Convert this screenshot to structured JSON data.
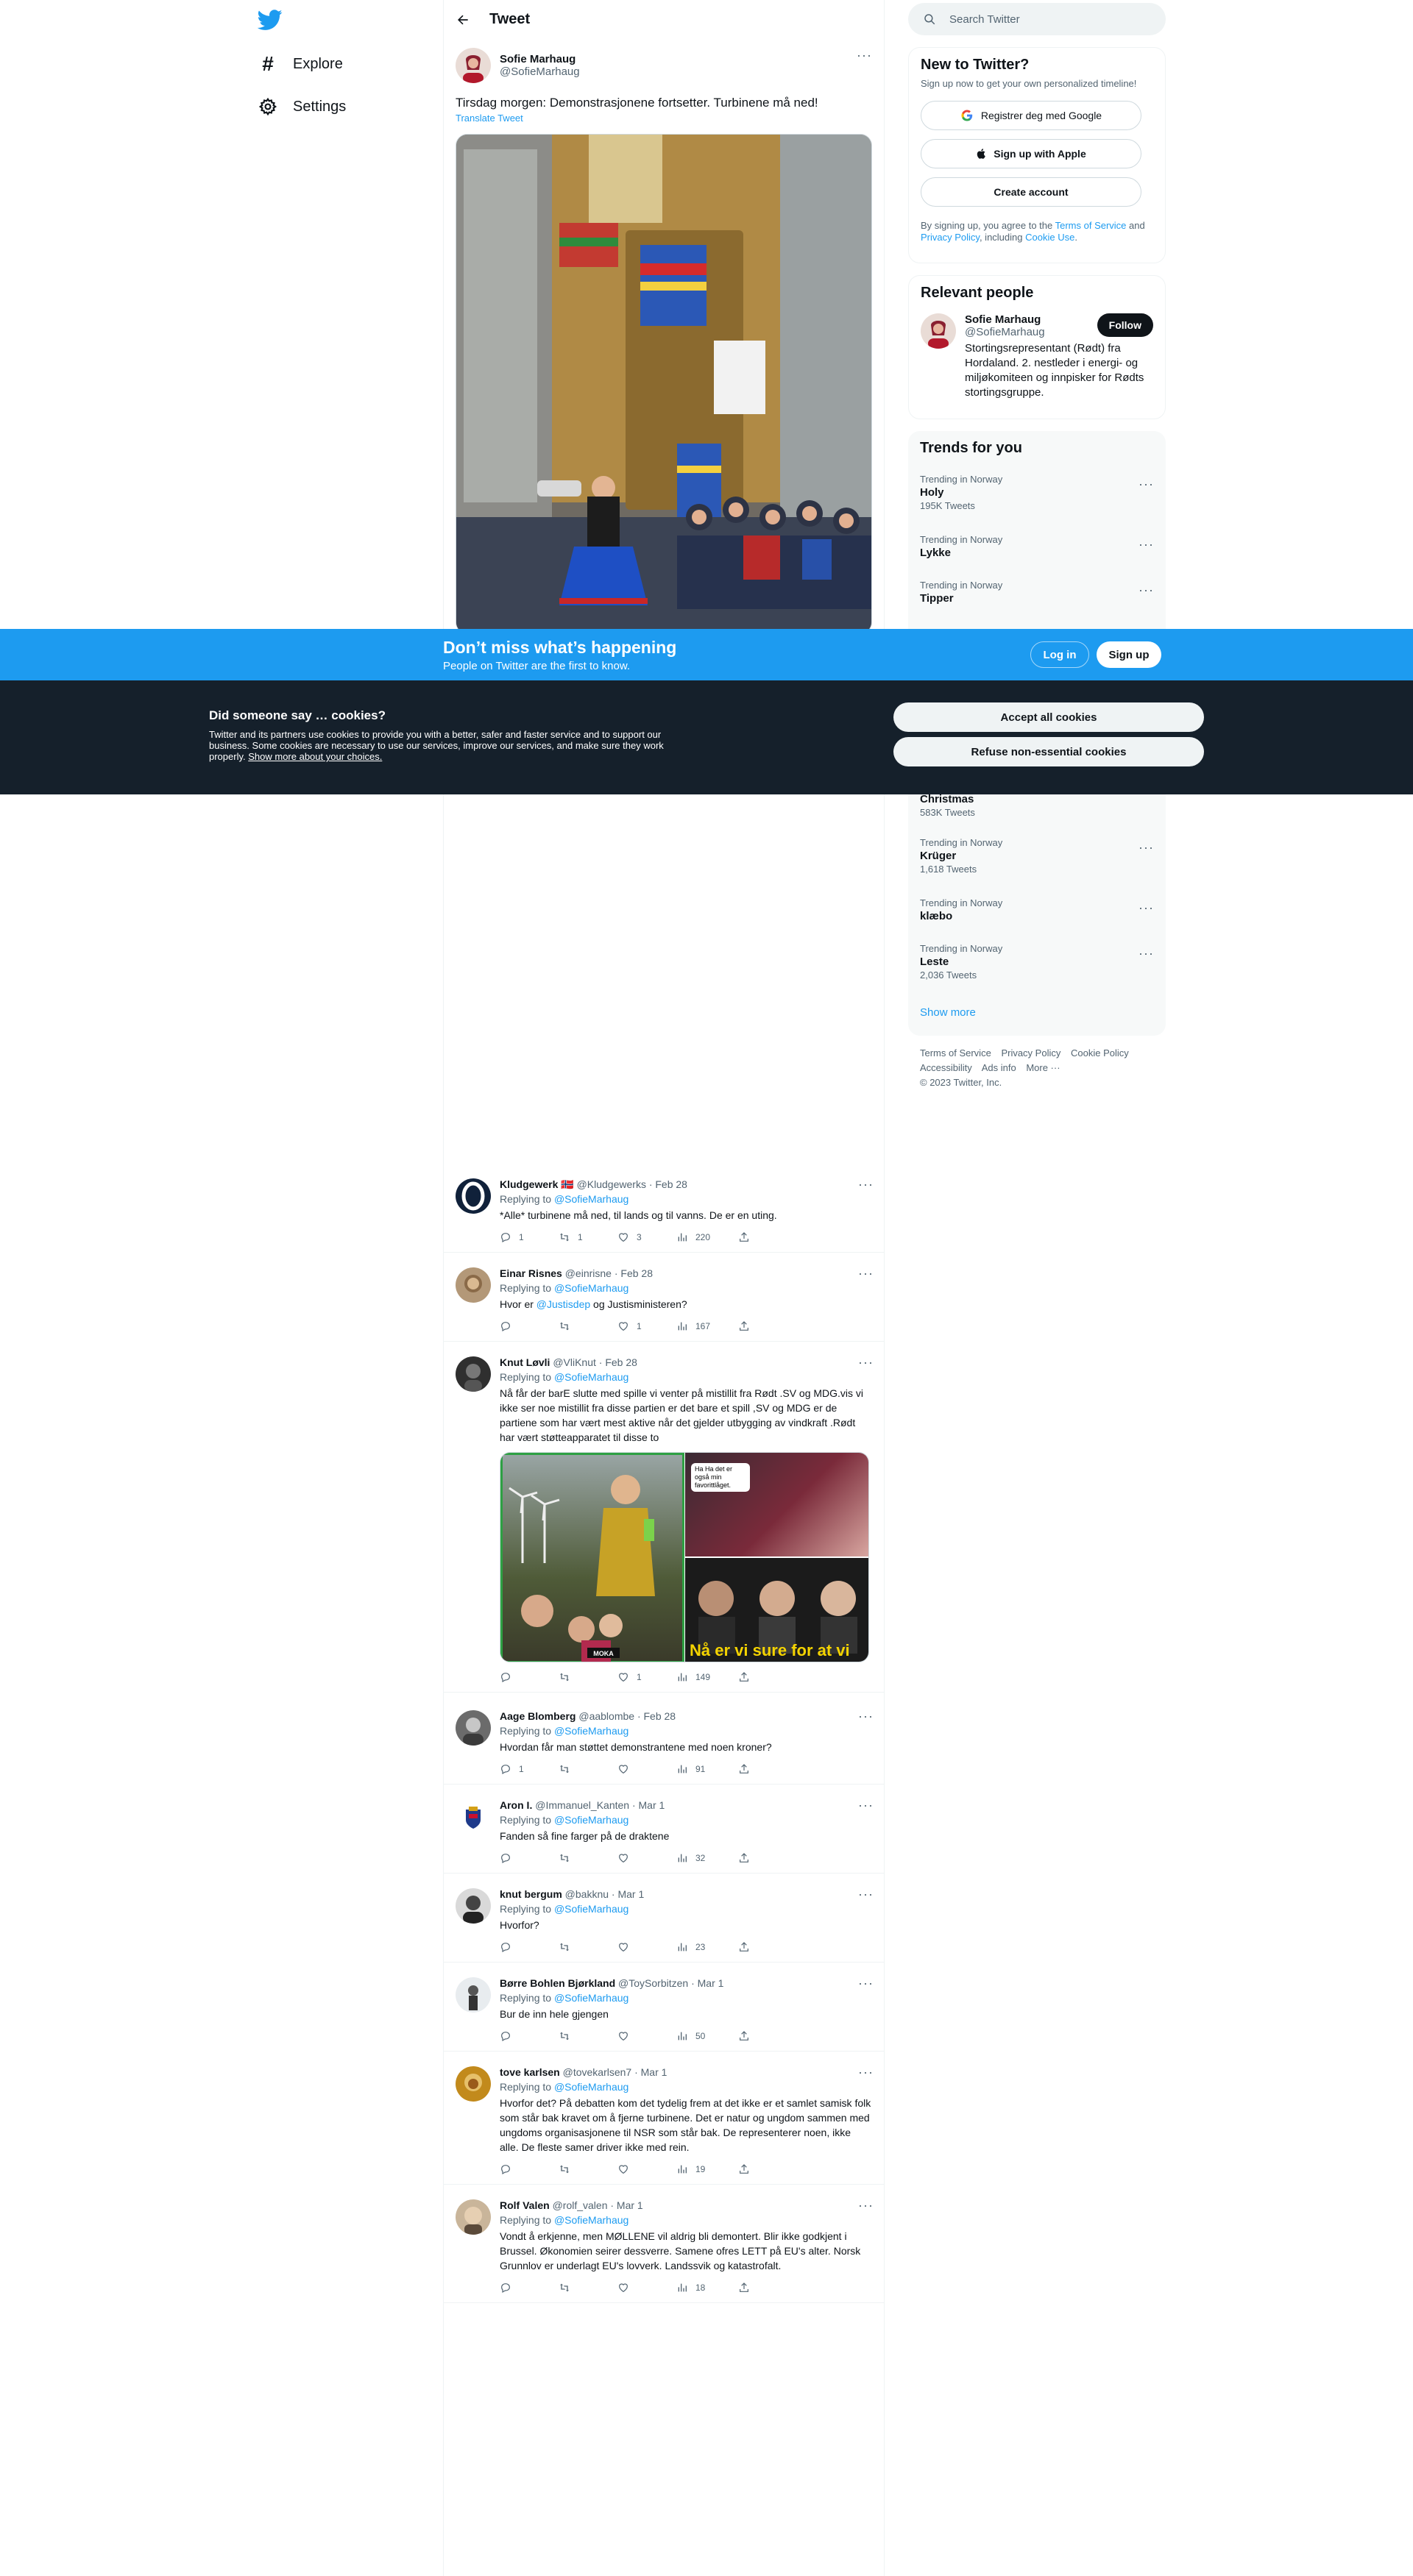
{
  "nav": {
    "items": [
      {
        "label": "Explore"
      },
      {
        "label": "Settings"
      }
    ]
  },
  "header": {
    "title": "Tweet"
  },
  "tweet": {
    "name": "Sofie Marhaug",
    "handle": "@SofieMarhaug",
    "text": "Tirsdag morgen: Demonstrasjonene fortsetter. Turbinene må ned!",
    "translate": "Translate Tweet"
  },
  "replies": [
    {
      "name": "Kludgewerk 🇳🇴",
      "meta": "@Kludgewerks · Feb 28",
      "replying_label": "Replying to",
      "replying_to": "@SofieMarhaug",
      "text": "*Alle* turbinene må ned, til lands og til vanns. De er en uting.",
      "replies": "1",
      "retweets": "1",
      "likes": "3",
      "views": "220"
    },
    {
      "name": "Einar Risnes",
      "meta": "@einrisne · Feb 28",
      "replying_label": "Replying to",
      "replying_to": "@SofieMarhaug",
      "text_pre": "Hvor er ",
      "text_mention": "@Justisdep",
      "text_post": " og Justisministeren?",
      "replies": "",
      "retweets": "",
      "likes": "1",
      "views": "167"
    },
    {
      "name": "Knut Løvli",
      "meta": "@VliKnut · Feb 28",
      "replying_label": "Replying to",
      "replying_to": "@SofieMarhaug",
      "text": "Nå får der barE slutte med spille vi venter på mistillit fra Rødt .SV og MDG.vis vi ikke ser noe mistillit fra disse partien er det bare et spill ,SV og MDG er de partiene som har vært mest aktive når det gjelder utbygging av vindkraft .Rødt har vært støtteapparatet til disse to",
      "photo_caption_1": "Ha Ha det er også min favorittlåget.",
      "photo_caption_2": "Nå er vi sure for at vi",
      "photo_badge": "MOKA",
      "replies": "",
      "retweets": "",
      "likes": "1",
      "views": "149"
    },
    {
      "name": "Aage Blomberg",
      "meta": "@aablombe · Feb 28",
      "replying_label": "Replying to",
      "replying_to": "@SofieMarhaug",
      "text": "Hvordan får man støttet demonstrantene med noen kroner?",
      "replies": "1",
      "retweets": "",
      "likes": "",
      "views": "91"
    },
    {
      "name": "Aron I.",
      "meta": "@Immanuel_Kanten · Mar 1",
      "replying_label": "Replying to",
      "replying_to": "@SofieMarhaug",
      "text": "Fanden så fine farger på de draktene",
      "replies": "",
      "retweets": "",
      "likes": "",
      "views": "32"
    },
    {
      "name": "knut bergum",
      "meta": "@bakknu · Mar 1",
      "replying_label": "Replying to",
      "replying_to": "@SofieMarhaug",
      "text": "Hvorfor?",
      "replies": "",
      "retweets": "",
      "likes": "",
      "views": "23"
    },
    {
      "name": "Børre Bohlen Bjørkland",
      "meta": "@ToySorbitzen · Mar 1",
      "replying_label": "Replying to",
      "replying_to": "@SofieMarhaug",
      "text": "Bur de inn hele gjengen",
      "replies": "",
      "retweets": "",
      "likes": "",
      "views": "50"
    },
    {
      "name": "tove karlsen",
      "meta": "@tovekarlsen7 · Mar 1",
      "replying_label": "Replying to",
      "replying_to": "@SofieMarhaug",
      "text": "Hvorfor det? På debatten kom det tydelig frem at det ikke er et samlet samisk folk som står bak kravet om å fjerne turbinene. Det er natur og ungdom sammen med ungdoms organisasjonene til NSR som står bak. De representerer noen, ikke alle. De fleste samer driver ikke med rein.",
      "replies": "",
      "retweets": "",
      "likes": "",
      "views": "19"
    },
    {
      "name": "Rolf Valen",
      "meta": "@rolf_valen · Mar 1",
      "replying_label": "Replying to",
      "replying_to": "@SofieMarhaug",
      "text": "Vondt å erkjenne, men MØLLENE vil aldrig bli demontert. Blir ikke godkjent i Brussel. Økonomien seirer dessverre. Samene ofres LETT på EU's alter. Norsk Grunnlov er underlagt EU's lovverk. Landssvik og katastrofalt.",
      "replies": "",
      "retweets": "",
      "likes": "",
      "views": "18"
    }
  ],
  "sidebar": {
    "search_placeholder": "Search Twitter",
    "new_to_twitter": {
      "title": "New to Twitter?",
      "subtitle": "Sign up now to get your own personalized timeline!",
      "google": "Registrer deg med Google",
      "apple": "Sign up with Apple",
      "create": "Create account",
      "legal_pre": "By signing up, you agree to the ",
      "tos": "Terms of Service",
      "legal_mid": " and ",
      "privacy": "Privacy Policy",
      "legal_mid2": ", including ",
      "cookie": "Cookie Use",
      "legal_end": "."
    },
    "relevant": {
      "title": "Relevant people",
      "name": "Sofie Marhaug",
      "handle": "@SofieMarhaug",
      "bio": "Stortingsrepresentant (Rødt) fra Hordaland. 2. nestleder i energi- og miljøkomiteen og innpisker for Rødts stortingsgruppe.",
      "follow": "Follow"
    },
    "trends": {
      "title": "Trends for you",
      "items": [
        {
          "context": "Trending in Norway",
          "name": "Holy",
          "count": "195K Tweets"
        },
        {
          "context": "Trending in Norway",
          "name": "Lykke",
          "count": ""
        },
        {
          "context": "Trending in Norway",
          "name": "Tipper",
          "count": ""
        },
        {
          "context": "",
          "name": "Christmas",
          "count": "583K Tweets"
        },
        {
          "context": "Trending in Norway",
          "name": "Krüger",
          "count": "1,618 Tweets"
        },
        {
          "context": "Trending in Norway",
          "name": "klæbo",
          "count": ""
        },
        {
          "context": "Trending in Norway",
          "name": "Leste",
          "count": "2,036 Tweets"
        }
      ],
      "show_more": "Show more"
    },
    "footer": {
      "links": [
        "Terms of Service",
        "Privacy Policy",
        "Cookie Policy",
        "Accessibility",
        "Ads info",
        "More ···"
      ],
      "copyright": "© 2023 Twitter, Inc."
    }
  },
  "signup_bar": {
    "title": "Don’t miss what’s happening",
    "subtitle": "People on Twitter are the first to know.",
    "login": "Log in",
    "signup": "Sign up"
  },
  "cookie_bar": {
    "title": "Did someone say … cookies?",
    "text": "Twitter and its partners use cookies to provide you with a better, safer and faster service and to support our business. Some cookies are necessary to use our services, improve our services, and make sure they work properly. ",
    "link": "Show more about your choices.",
    "accept": "Accept all cookies",
    "refuse": "Refuse non-essential cookies"
  },
  "colors": {
    "accent": "#1d9bf0",
    "text": "#0f1419",
    "muted": "#536471",
    "cookie_bg": "#15202b"
  },
  "icons": [
    "twitter-logo-icon",
    "hashtag-icon",
    "gear-icon",
    "back-arrow-icon",
    "search-icon",
    "google-icon",
    "apple-icon",
    "reply-icon",
    "retweet-icon",
    "like-icon",
    "views-icon",
    "share-icon",
    "more-icon"
  ]
}
